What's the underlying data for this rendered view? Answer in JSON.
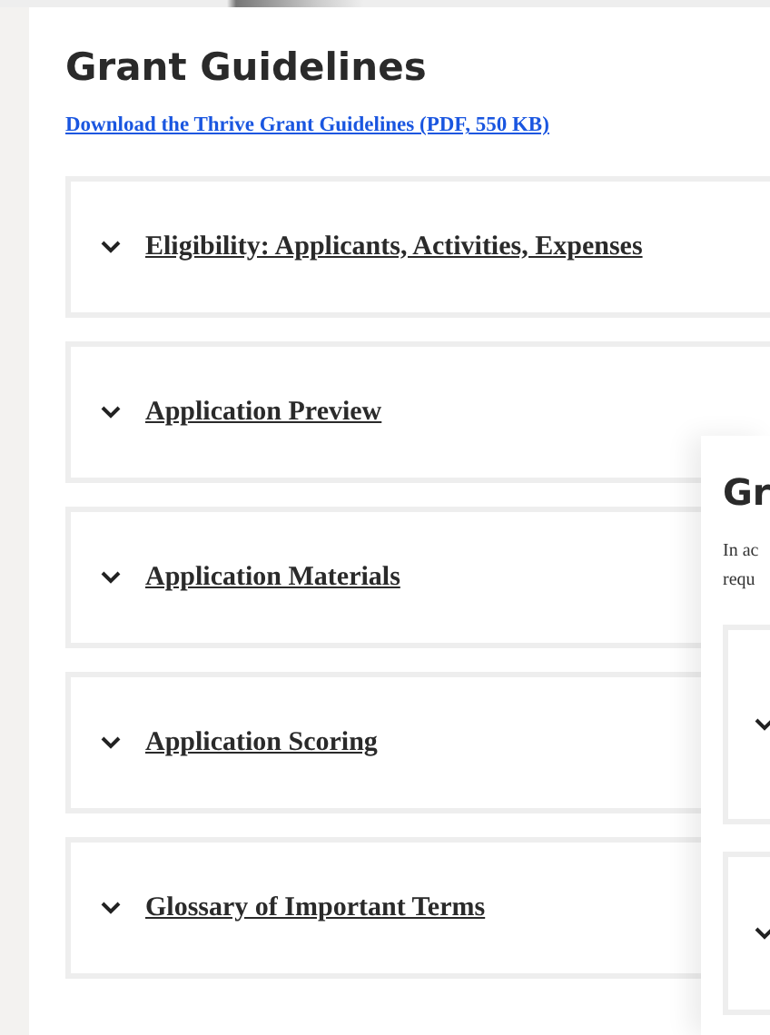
{
  "page": {
    "title": "Grant Guidelines",
    "download_link": "Download the Thrive Grant Guidelines (PDF, 550 KB)",
    "sections": [
      {
        "label": "Eligibility: Applicants, Activities, Expenses",
        "expanded": false
      },
      {
        "label": "Application Preview",
        "expanded": false
      },
      {
        "label": "Application Materials",
        "expanded": false
      },
      {
        "label": "Application Scoring",
        "expanded": false
      },
      {
        "label": "Glossary of Important Terms",
        "expanded": false
      }
    ]
  },
  "overlay_card": {
    "title": "Gr",
    "intro_lines": [
      "In ac",
      "requ"
    ],
    "sections": [
      {
        "expanded": false
      },
      {
        "expanded": false
      }
    ]
  }
}
